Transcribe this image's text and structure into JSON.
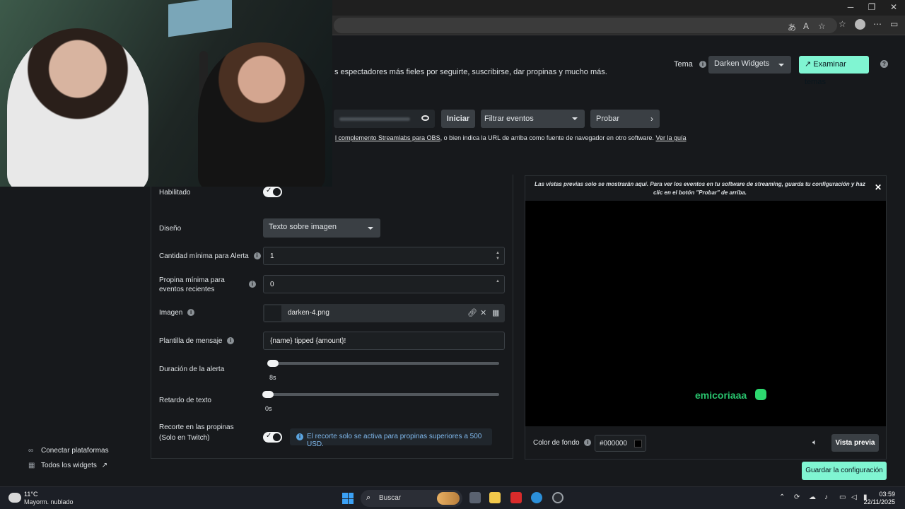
{
  "browser": {
    "controls": {
      "minimize": "─",
      "restore": "❐",
      "close": "✕"
    }
  },
  "header": {
    "description": "s espectadores más fieles por seguirte, suscribirse, dar propinas y mucho más.",
    "tema_label": "Tema",
    "tema_value": "Darken Widgets",
    "examinar_label": "Examinar temas"
  },
  "toolbar": {
    "iniciar_label": "Iniciar",
    "filtrar_label": "Filtrar eventos",
    "probar_label": "Probar",
    "obs_prefix": "l complemento Streamlabs para OBS",
    "obs_text": ", o bien indica la URL de arriba como fuente de navegador en otro software.",
    "obs_link": "Ver la guía"
  },
  "settings": {
    "habilitado_label": "Habilitado",
    "diseno_label": "Diseño",
    "diseno_value": "Texto sobre imagen",
    "cantidad_label": "Cantidad mínima para Alerta",
    "cantidad_value": "1",
    "propina_label": "Propina mínima para eventos recientes",
    "propina_value": "0",
    "imagen_label": "Imagen",
    "imagen_value": "darken-4.png",
    "plantilla_label": "Plantilla de mensaje",
    "plantilla_value": "{name} tipped {amount}!",
    "duracion_label": "Duración de la alerta",
    "duracion_value": "8s",
    "retardo_label": "Retardo de texto",
    "retardo_value": "0s",
    "recorte_label": "Recorte en las propinas (Solo en Twitch)",
    "recorte_info": "El recorte solo se activa para propinas superiores a 500 USD."
  },
  "sidebar": {
    "conectar": "Conectar plataformas",
    "todos": "Todos los widgets"
  },
  "preview": {
    "note": "Las vistas previas solo se mostrarán aquí. Para ver los eventos en tu software de streaming, guarda tu configuración y haz clic en el botón \"Probar\" de arriba.",
    "alert_name": "emicoriaaa",
    "bg_label": "Color de fondo",
    "bg_value": "#000000",
    "vista_label": "Vista previa"
  },
  "save_label": "Guardar la configuración",
  "taskbar": {
    "temp": "11°C",
    "weather": "Mayorm. nublado",
    "search": "Buscar",
    "time": "03:59",
    "date": "22/11/2025"
  },
  "colors": {
    "accent": "#80f5d2",
    "alert_green": "#29c46e",
    "info_blue": "#7fb8ec"
  }
}
